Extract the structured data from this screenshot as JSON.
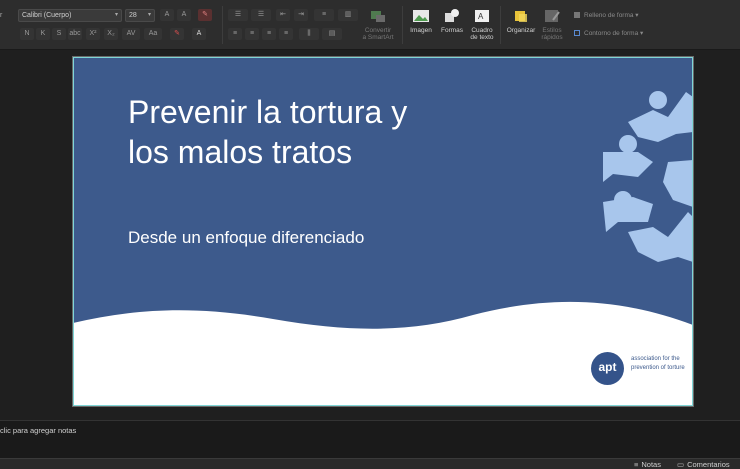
{
  "ribbon": {
    "font_name": "Calibri (Cuerpo)",
    "font_size": "28",
    "format_buttons": [
      "N",
      "K",
      "S",
      "abc",
      "X²",
      "X₂",
      "AV",
      "Aa"
    ],
    "convert_smartart": "Convertir\na SmartArt",
    "image": "Imagen",
    "shapes": "Formas",
    "textbox": "Cuadro\nde texto",
    "arrange": "Organizar",
    "quick_styles": "Estilos\nrápidos",
    "shape_fill": "Relleno de forma",
    "shape_outline": "Contorno de forma"
  },
  "slide": {
    "title": "Prevenir la tortura y los malos tratos",
    "subtitle": "Desde un enfoque diferenciado",
    "logo_text": "apt",
    "org_name": "association for the prevention of torture"
  },
  "notes": {
    "placeholder": "clic para agregar notas"
  },
  "status": {
    "notes_label": "Notas",
    "comments_label": "Comentarios"
  },
  "colors": {
    "slide_blue": "#3d5a8c",
    "figures": "#a8c6ec",
    "accent_border": "#7fd6d6"
  },
  "icons": [
    "image-icon",
    "shapes-icon",
    "textbox-icon",
    "arrange-icon",
    "styles-icon",
    "smartart-icon",
    "notes-icon",
    "comments-icon",
    "fill-icon",
    "outline-icon"
  ]
}
